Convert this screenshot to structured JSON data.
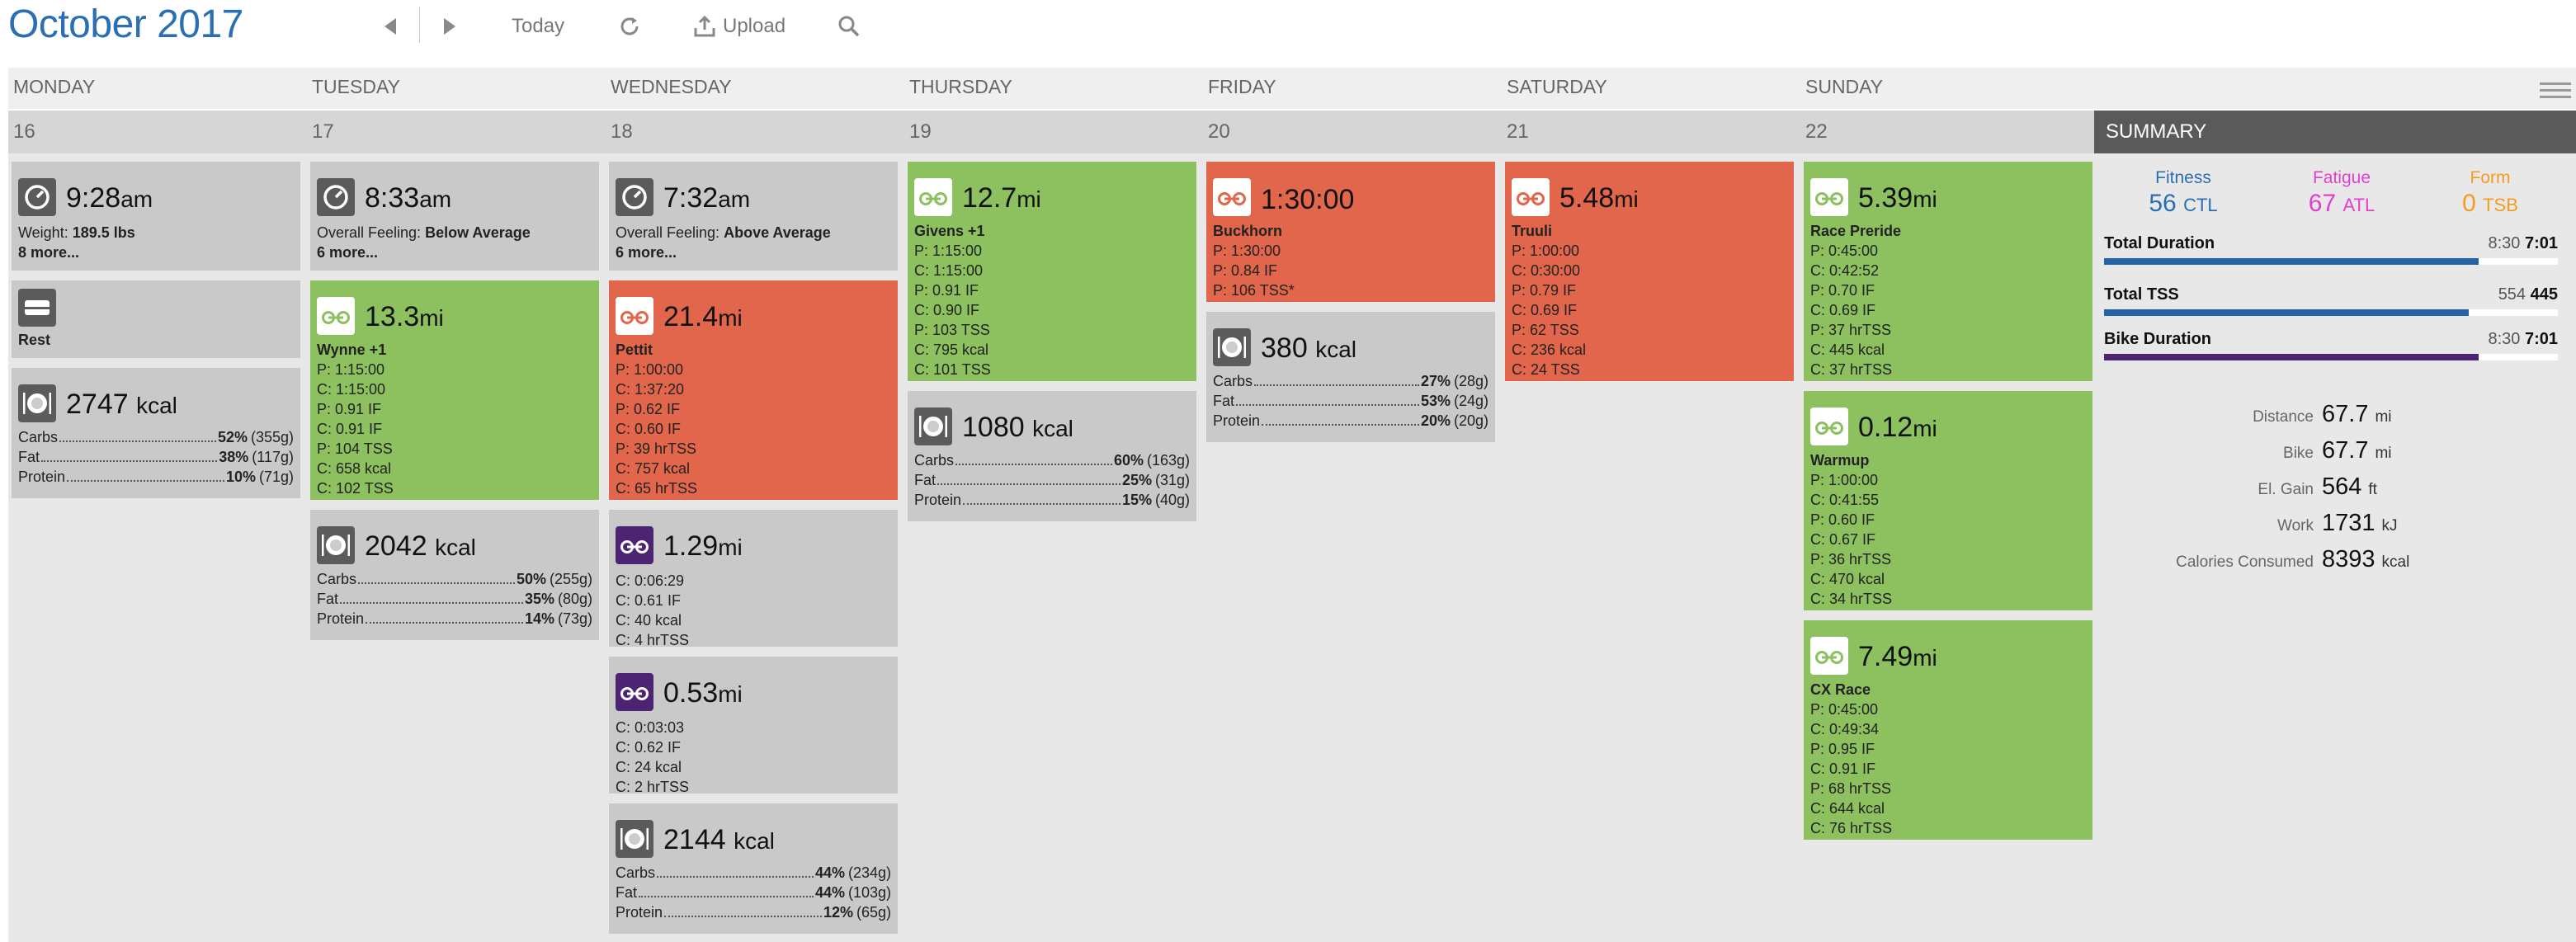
{
  "header": {
    "month": "October",
    "year": "2017",
    "today_label": "Today",
    "upload_label": "Upload",
    "icons": [
      "prev-arrow-icon",
      "next-arrow-icon",
      "refresh-icon",
      "upload-icon",
      "search-icon",
      "menu-icon"
    ]
  },
  "weekdays": [
    "MONDAY",
    "TUESDAY",
    "WEDNESDAY",
    "THURSDAY",
    "FRIDAY",
    "SATURDAY",
    "SUNDAY"
  ],
  "dates": [
    "16",
    "17",
    "18",
    "19",
    "20",
    "21",
    "22"
  ],
  "colors": {
    "brand_blue": "#2a6fb3",
    "workout_completed": "#8dc05e",
    "workout_missed": "#e2664b",
    "card_neutral": "#c9c9c9",
    "bar_blue": "#2563a7",
    "bar_purple": "#4d2474",
    "fitness": "#2a6fb3",
    "fatigue": "#e23fd0",
    "form": "#f39c1f"
  },
  "days": {
    "mon": {
      "metrics": {
        "time": "9:28",
        "ampm": "am",
        "weight_label": "Weight:",
        "weight_value": "189.5 lbs",
        "more": "8 more..."
      },
      "rest": {
        "label": "Rest"
      },
      "nutrition": {
        "kcal": "2747",
        "unit": "kcal",
        "carbs": "52%",
        "carbs_g": "(355g)",
        "fat": "38%",
        "fat_g": "(117g)",
        "protein": "10%",
        "protein_g": "(71g)"
      }
    },
    "tue": {
      "metrics": {
        "time": "8:33",
        "ampm": "am",
        "feeling_label": "Overall Feeling:",
        "feeling_value": "Below Average",
        "more": "6 more..."
      },
      "workout": {
        "dist": "13.3",
        "unit": "mi",
        "title": "Wynne +1",
        "lines": [
          "P: 1:15:00",
          "C: 1:15:00",
          "P: 0.91 IF",
          "C: 0.91 IF",
          "P: 104 TSS",
          "C: 658 kcal",
          "C: 102 TSS"
        ]
      },
      "nutrition": {
        "kcal": "2042",
        "unit": "kcal",
        "carbs": "50%",
        "carbs_g": "(255g)",
        "fat": "35%",
        "fat_g": "(80g)",
        "protein": "14%",
        "protein_g": "(73g)"
      }
    },
    "wed": {
      "metrics": {
        "time": "7:32",
        "ampm": "am",
        "feeling_label": "Overall Feeling:",
        "feeling_value": "Above Average",
        "more": "6 more..."
      },
      "workout": {
        "dist": "21.4",
        "unit": "mi",
        "title": "Pettit",
        "lines": [
          "P: 1:00:00",
          "C: 1:37:20",
          "P: 0.62 IF",
          "C: 0.60 IF",
          "P: 39 hrTSS",
          "C: 757 kcal",
          "C: 65 hrTSS"
        ]
      },
      "extra1": {
        "dist": "1.29",
        "unit": "mi",
        "lines": [
          "C: 0:06:29",
          "C: 0.61 IF",
          "C: 40 kcal",
          "C: 4 hrTSS"
        ]
      },
      "extra2": {
        "dist": "0.53",
        "unit": "mi",
        "lines": [
          "C: 0:03:03",
          "C: 0.62 IF",
          "C: 24 kcal",
          "C: 2 hrTSS"
        ]
      },
      "nutrition": {
        "kcal": "2144",
        "unit": "kcal",
        "carbs": "44%",
        "carbs_g": "(234g)",
        "fat": "44%",
        "fat_g": "(103g)",
        "protein": "12%",
        "protein_g": "(65g)"
      }
    },
    "thu": {
      "workout": {
        "dist": "12.7",
        "unit": "mi",
        "title": "Givens +1",
        "lines": [
          "P: 1:15:00",
          "C: 1:15:00",
          "P: 0.91 IF",
          "C: 0.90 IF",
          "P: 103 TSS",
          "C: 795 kcal",
          "C: 101 TSS"
        ]
      },
      "nutrition": {
        "kcal": "1080",
        "unit": "kcal",
        "carbs": "60%",
        "carbs_g": "(163g)",
        "fat": "25%",
        "fat_g": "(31g)",
        "protein": "15%",
        "protein_g": "(40g)"
      }
    },
    "fri": {
      "workout": {
        "dist": "1:30:00",
        "unit": "",
        "title": "Buckhorn",
        "lines": [
          "P: 1:30:00",
          "P: 0.84 IF",
          "P: 106 TSS*"
        ]
      },
      "nutrition": {
        "kcal": "380",
        "unit": "kcal",
        "carbs": "27%",
        "carbs_g": "(28g)",
        "fat": "53%",
        "fat_g": "(24g)",
        "protein": "20%",
        "protein_g": "(20g)"
      }
    },
    "sat": {
      "workout": {
        "dist": "5.48",
        "unit": "mi",
        "title": "Truuli",
        "lines": [
          "P: 1:00:00",
          "C: 0:30:00",
          "P: 0.79 IF",
          "C: 0.69 IF",
          "P: 62 TSS",
          "C: 236 kcal",
          "C: 24 TSS"
        ]
      }
    },
    "sun": {
      "workout1": {
        "dist": "5.39",
        "unit": "mi",
        "title": "Race Preride",
        "lines": [
          "P: 0:45:00",
          "C: 0:42:52",
          "P: 0.70 IF",
          "C: 0.69 IF",
          "P: 37 hrTSS",
          "C: 445 kcal",
          "C: 37 hrTSS"
        ]
      },
      "workout2": {
        "dist": "0.12",
        "unit": "mi",
        "title": "Warmup",
        "lines": [
          "P: 1:00:00",
          "C: 0:41:55",
          "P: 0.60 IF",
          "C: 0.67 IF",
          "P: 36 hrTSS",
          "C: 470 kcal",
          "C: 34 hrTSS"
        ]
      },
      "workout3": {
        "dist": "7.49",
        "unit": "mi",
        "title": "CX Race",
        "lines": [
          "P: 0:45:00",
          "C: 0:49:34",
          "P: 0.95 IF",
          "C: 0.91 IF",
          "P: 68 hrTSS",
          "C: 644 kcal",
          "C: 76 hrTSS"
        ]
      }
    }
  },
  "macro_labels": {
    "carbs": "Carbs",
    "fat": "Fat",
    "protein": "Protein"
  },
  "summary": {
    "title": "SUMMARY",
    "fitness": {
      "label": "Fitness",
      "value": "56",
      "unit": "CTL"
    },
    "fatigue": {
      "label": "Fatigue",
      "value": "67",
      "unit": "ATL"
    },
    "form": {
      "label": "Form",
      "value": "0",
      "unit": "TSB"
    },
    "bars": [
      {
        "label": "Total Duration",
        "planned": "8:30",
        "completed": "7:01",
        "fraction": 0.825,
        "color": "blue"
      },
      {
        "label": "Total TSS",
        "planned": "554",
        "completed": "445",
        "fraction": 0.803,
        "color": "blue"
      },
      {
        "label": "Bike Duration",
        "planned": "8:30",
        "completed": "7:01",
        "fraction": 0.825,
        "color": "purple"
      }
    ],
    "stats": [
      {
        "label": "Distance",
        "value": "67.7",
        "unit": "mi"
      },
      {
        "label": "Bike",
        "value": "67.7",
        "unit": "mi"
      },
      {
        "label": "El. Gain",
        "value": "564",
        "unit": "ft"
      },
      {
        "label": "Work",
        "value": "1731",
        "unit": "kJ"
      },
      {
        "label": "Calories Consumed",
        "value": "8393",
        "unit": "kcal"
      }
    ]
  }
}
